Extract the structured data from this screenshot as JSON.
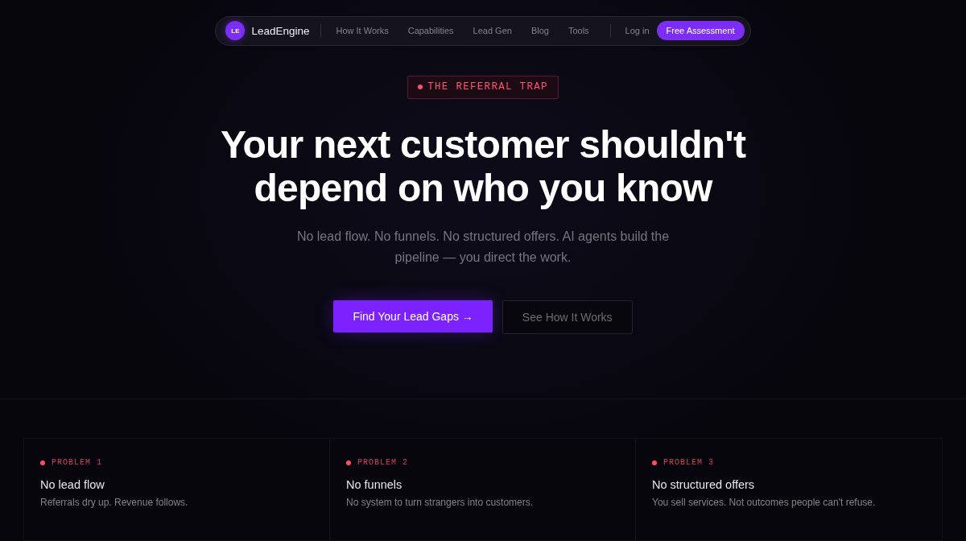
{
  "nav": {
    "logo_mark": "LE",
    "brand": "LeadEngine",
    "links": [
      {
        "label": "How It Works"
      },
      {
        "label": "Capabilities"
      },
      {
        "label": "Lead Gen"
      },
      {
        "label": "Blog"
      },
      {
        "label": "Tools"
      }
    ],
    "login": "Log in",
    "cta": "Free Assessment"
  },
  "hero": {
    "badge": "THE REFERRAL TRAP",
    "headline_lines": [
      "Your next customer shouldn't",
      "depend on who you know"
    ],
    "subtitle": "No lead flow. No funnels. No structured offers. AI agents build the pipeline — you direct the work.",
    "primary_button": "Find Your Lead Gaps →",
    "secondary_button": "See How It Works"
  },
  "problems": [
    {
      "tag": "PROBLEM 1",
      "title": "No lead flow",
      "text": "Referrals dry up. Revenue follows."
    },
    {
      "tag": "PROBLEM 2",
      "title": "No funnels",
      "text": "No system to turn strangers into customers."
    },
    {
      "tag": "PROBLEM 3",
      "title": "No structured offers",
      "text": "You sell services. Not outcomes people can't refuse."
    }
  ]
}
